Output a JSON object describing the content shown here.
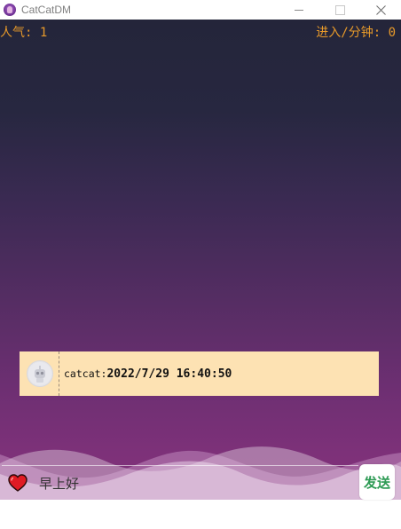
{
  "window": {
    "title": "CatCatDM"
  },
  "stats": {
    "popularity": "人气: 1",
    "entries_per_min": "进入/分钟: 0"
  },
  "danmaku": {
    "user": "catcat:",
    "time": "2022/7/29 16:40:50"
  },
  "input": {
    "value": "早上好"
  },
  "send_button": {
    "label": "发送"
  },
  "colors": {
    "stat_text": "#e89a2a",
    "card_bg": "#fde2b3",
    "send_text": "#2e9b55",
    "heart": "#e01b24"
  }
}
